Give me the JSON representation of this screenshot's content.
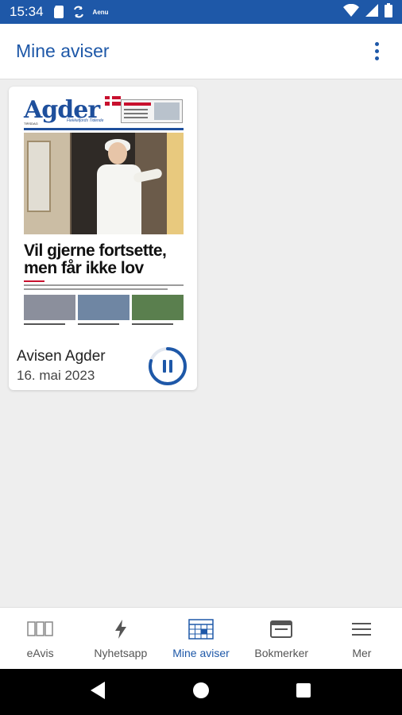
{
  "status_bar": {
    "time": "15:34",
    "app_label": "Aenu",
    "icons": [
      "sd-card-icon",
      "sync-icon",
      "wifi-icon",
      "signal-icon",
      "battery-icon"
    ]
  },
  "app_bar": {
    "title": "Mine aviser",
    "menu_icon": "more-vertical-icon"
  },
  "newspaper": {
    "name": "Avisen Agder",
    "date": "16. mai 2023",
    "cover": {
      "masthead": "Agder",
      "masthead_sub": "Flekkefjords Tidende",
      "tagline": "TIRSDAG",
      "headline_line1": "Vil gjerne fortsette,",
      "headline_line2": "men får ikke lov"
    },
    "action_icon": "pause-download-icon",
    "download_progress": 0.8
  },
  "bottom_nav": [
    {
      "label": "eAvis",
      "icon": "eavis-pages-icon",
      "active": false
    },
    {
      "label": "Nyhetsapp",
      "icon": "lightning-icon",
      "active": false
    },
    {
      "label": "Mine aviser",
      "icon": "calendar-grid-icon",
      "active": true
    },
    {
      "label": "Bokmerker",
      "icon": "bookmark-window-icon",
      "active": false
    },
    {
      "label": "Mer",
      "icon": "hamburger-menu-icon",
      "active": false
    }
  ],
  "colors": {
    "primary": "#1e58a8",
    "background": "#eeeeee",
    "surface": "#ffffff"
  }
}
